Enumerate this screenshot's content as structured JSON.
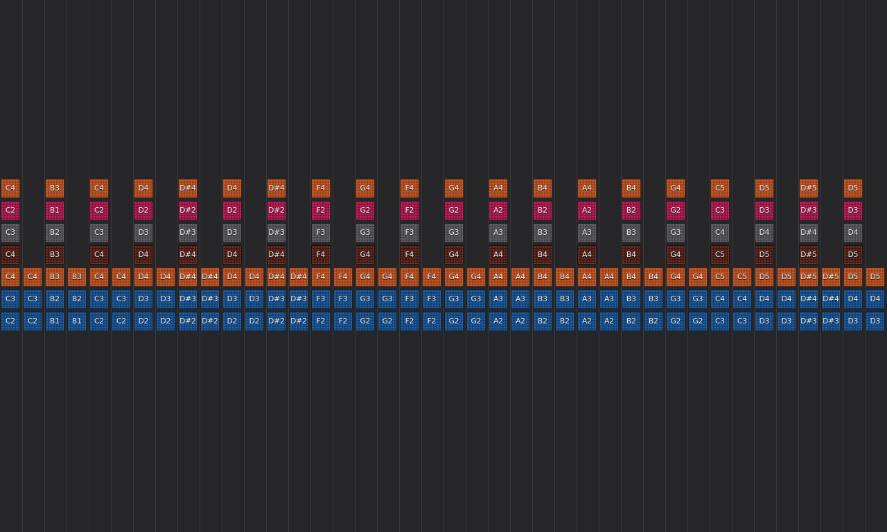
{
  "colors": {
    "background": "#262628",
    "grid_line": "#3a3a3d",
    "orange": "#b04a1c",
    "magenta": "#a01446",
    "gray": "#4e4e50",
    "maroon": "#4a1c14",
    "blue": "#124a88"
  },
  "rows": [
    {
      "name": "orange-top",
      "color_key": "orange",
      "notes": [
        "C4",
        "B3",
        "C4",
        "D4",
        "D#4",
        "D4",
        "D#4",
        "F4",
        "G4",
        "F4",
        "G4",
        "A4",
        "B4",
        "A4",
        "B4",
        "G4",
        "C5",
        "D5",
        "D#5",
        "D5"
      ]
    },
    {
      "name": "magenta",
      "color_key": "magenta",
      "notes": [
        "C2",
        "B1",
        "C2",
        "D2",
        "D#2",
        "D2",
        "D#2",
        "F2",
        "G2",
        "F2",
        "G2",
        "A2",
        "B2",
        "A2",
        "B2",
        "G2",
        "C3",
        "D3",
        "D#3",
        "D3"
      ]
    },
    {
      "name": "gray",
      "color_key": "gray",
      "notes": [
        "C3",
        "B2",
        "C3",
        "D3",
        "D#3",
        "D3",
        "D#3",
        "F3",
        "G3",
        "F3",
        "G3",
        "A3",
        "B3",
        "A3",
        "B3",
        "G3",
        "C4",
        "D4",
        "D#4",
        "D4"
      ]
    },
    {
      "name": "maroon",
      "color_key": "maroon",
      "notes": [
        "C4",
        "B3",
        "C4",
        "D4",
        "D#4",
        "D4",
        "D#4",
        "F4",
        "G4",
        "F4",
        "G4",
        "A4",
        "B4",
        "A4",
        "B4",
        "G4",
        "C5",
        "D5",
        "D#5",
        "D5"
      ]
    },
    {
      "name": "orange-dense",
      "color_key": "orange",
      "notes": [
        "C4",
        "C4",
        "B3",
        "B3",
        "C4",
        "C4",
        "D4",
        "D4",
        "D#4",
        "D#4",
        "D4",
        "D4",
        "D#4",
        "D#4",
        "F4",
        "F4",
        "G4",
        "G4",
        "F4",
        "F4",
        "G4",
        "G4",
        "A4",
        "A4",
        "B4",
        "B4",
        "A4",
        "A4",
        "B4",
        "B4",
        "G4",
        "G4",
        "C5",
        "C5",
        "D5",
        "D5",
        "D#5",
        "D#5",
        "D5",
        "D5"
      ]
    },
    {
      "name": "blue-upper",
      "color_key": "blue",
      "notes": [
        "C3",
        "C3",
        "B2",
        "B2",
        "C3",
        "C3",
        "D3",
        "D3",
        "D#3",
        "D#3",
        "D3",
        "D3",
        "D#3",
        "D#3",
        "F3",
        "F3",
        "G3",
        "G3",
        "F3",
        "F3",
        "G3",
        "G3",
        "A3",
        "A3",
        "B3",
        "B3",
        "A3",
        "A3",
        "B3",
        "B3",
        "G3",
        "G3",
        "C4",
        "C4",
        "D4",
        "D4",
        "D#4",
        "D#4",
        "D4",
        "D4"
      ]
    },
    {
      "name": "blue-lower",
      "color_key": "blue",
      "notes": [
        "C2",
        "C2",
        "B1",
        "B1",
        "C2",
        "C2",
        "D2",
        "D2",
        "D#2",
        "D#2",
        "D2",
        "D2",
        "D#2",
        "D#2",
        "F2",
        "F2",
        "G2",
        "G2",
        "F2",
        "F2",
        "G2",
        "G2",
        "A2",
        "A2",
        "B2",
        "B2",
        "A2",
        "A2",
        "B2",
        "B2",
        "G2",
        "G2",
        "C3",
        "C3",
        "D3",
        "D3",
        "D#3",
        "D#3",
        "D3",
        "D3"
      ]
    }
  ]
}
